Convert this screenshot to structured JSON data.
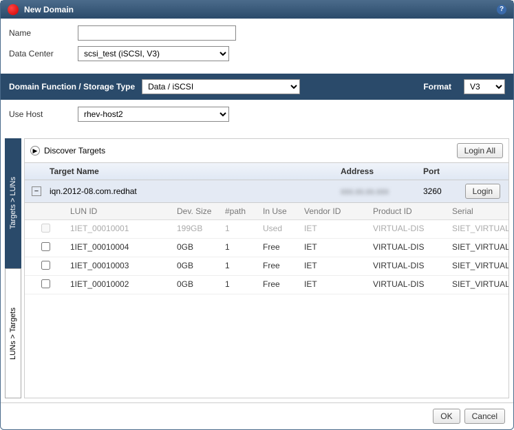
{
  "title": "New Domain",
  "form": {
    "name_label": "Name",
    "name_value": "",
    "dc_label": "Data Center",
    "dc_value": "scsi_test (iSCSI, V3)",
    "host_label": "Use Host",
    "host_value": "rhev-host2"
  },
  "bar": {
    "type_label": "Domain Function / Storage Type",
    "type_value": "Data / iSCSI",
    "format_label": "Format",
    "format_value": "V3"
  },
  "tabs": {
    "tl": "Targets > LUNs",
    "lt": "LUNs > Targets"
  },
  "discover": {
    "label": "Discover Targets",
    "login_all": "Login All"
  },
  "thead": {
    "name": "Target Name",
    "addr": "Address",
    "port": "Port"
  },
  "target": {
    "name": "iqn.2012-08.com.redhat",
    "addr": "xxx.xx.xx.xxx",
    "port": "3260",
    "login": "Login"
  },
  "lhead": {
    "id": "LUN ID",
    "size": "Dev. Size",
    "path": "#path",
    "use": "In Use",
    "vendor": "Vendor ID",
    "prod": "Product ID",
    "serial": "Serial"
  },
  "luns": [
    {
      "id": "1IET_00010001",
      "size": "199GB",
      "path": "1",
      "use": "Used",
      "vendor": "IET",
      "prod": "VIRTUAL-DIS",
      "serial": "SIET_VIRTUAL-",
      "disabled": true
    },
    {
      "id": "1IET_00010004",
      "size": "0GB",
      "path": "1",
      "use": "Free",
      "vendor": "IET",
      "prod": "VIRTUAL-DIS",
      "serial": "SIET_VIRTUAL-",
      "disabled": false
    },
    {
      "id": "1IET_00010003",
      "size": "0GB",
      "path": "1",
      "use": "Free",
      "vendor": "IET",
      "prod": "VIRTUAL-DIS",
      "serial": "SIET_VIRTUAL-",
      "disabled": false
    },
    {
      "id": "1IET_00010002",
      "size": "0GB",
      "path": "1",
      "use": "Free",
      "vendor": "IET",
      "prod": "VIRTUAL-DIS",
      "serial": "SIET_VIRTUAL-",
      "disabled": false
    }
  ],
  "footer": {
    "ok": "OK",
    "cancel": "Cancel"
  }
}
